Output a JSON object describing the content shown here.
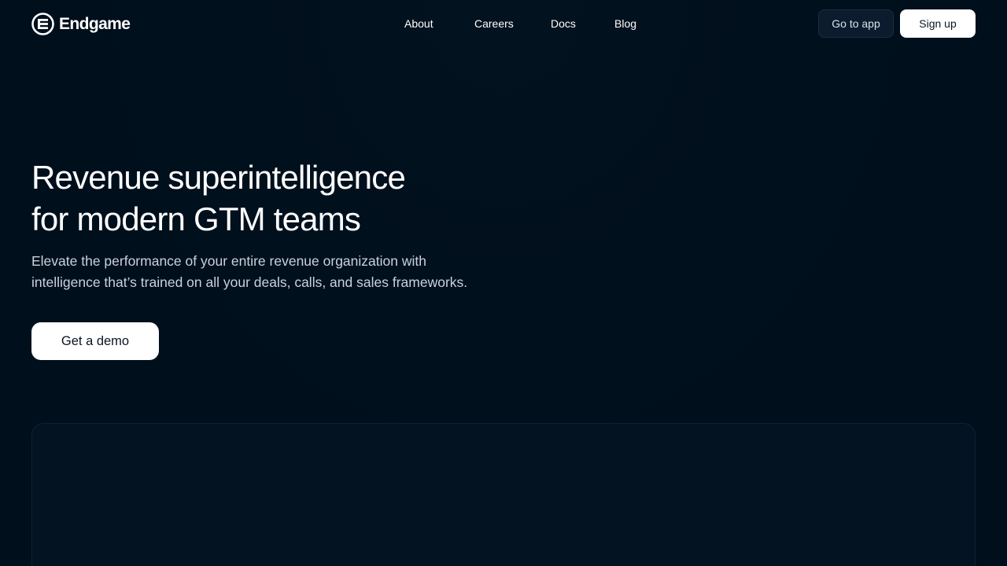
{
  "header": {
    "brand": {
      "name": "Endgame",
      "icon": "endgame-logo-icon"
    },
    "nav": [
      {
        "label": "About"
      },
      {
        "label": "Careers"
      },
      {
        "label": "Docs"
      },
      {
        "label": "Blog"
      }
    ],
    "go_to_app_label": "Go to app",
    "sign_up_label": "Sign up"
  },
  "hero": {
    "title_lines": [
      "Revenue superintelligence",
      "for modern GTM teams"
    ],
    "subtitle_lines": [
      "Elevate the performance of your entire revenue organization with",
      "intelligence that’s trained on all your deals, calls, and sales frameworks."
    ],
    "cta_label": "Get a demo"
  },
  "colors": {
    "background": "#000f1c",
    "panel": "#031322",
    "primary_button": "#ffffff",
    "secondary_button": "#0c1c2e",
    "text_primary": "#ffffff",
    "text_secondary": "#c9d2dc"
  }
}
